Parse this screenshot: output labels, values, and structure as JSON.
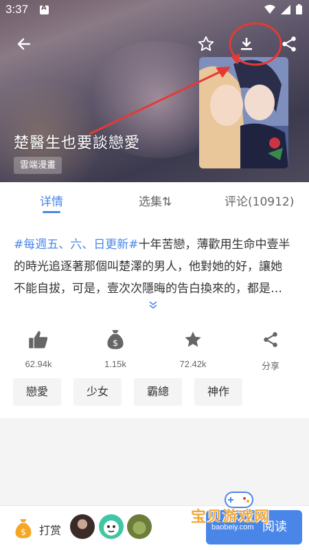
{
  "status_bar": {
    "time": "3:37"
  },
  "header": {
    "title": "楚醫生也要談戀愛",
    "author_tag": "雲端漫畫"
  },
  "tabs": [
    {
      "label": "详情",
      "active": true
    },
    {
      "label": "选集⇅"
    },
    {
      "label": "评论(10912)"
    }
  ],
  "description": {
    "hashtag": "#每週五、六、日更新#",
    "line1_rest": "十年苦戀，薄歡用生命中壹半",
    "line2": "的時光追逐著那個叫楚澤的男人，他對她的好，讓她",
    "line3": "不能自拔，可是，壹次次隱晦的告白換來的，都是…"
  },
  "stats": {
    "likes": "62.94k",
    "coins": "1.15k",
    "favorites": "72.42k",
    "share": "分享"
  },
  "tags": [
    "戀愛",
    "少女",
    "霸總",
    "神作"
  ],
  "bottom": {
    "tip_label": "打赏",
    "read_label": "阅读"
  },
  "watermark": {
    "text": "宝贝游戏网",
    "url": "baobeiy.com"
  },
  "colors": {
    "accent": "#4a86e8",
    "annotation": "#e53935"
  }
}
